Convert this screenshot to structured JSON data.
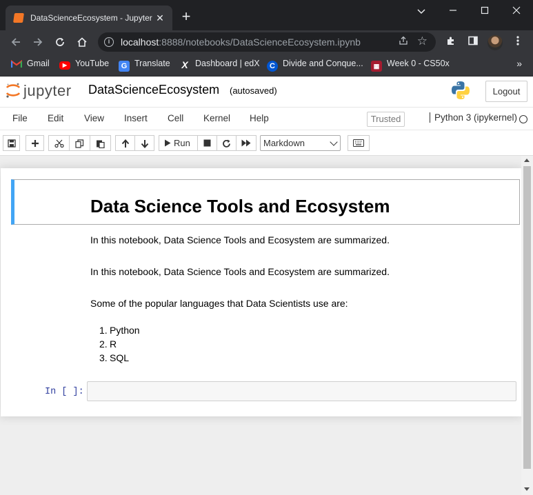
{
  "browser": {
    "tab_title": "DataScienceEcosystem - Jupyter Notebook",
    "url_host": "localhost",
    "url_rest": ":8888/notebooks/DataScienceEcosystem.ipynb",
    "bookmarks": [
      {
        "label": "Gmail",
        "icon": "gmail-icon",
        "color": "#ea4335"
      },
      {
        "label": "YouTube",
        "icon": "youtube-icon",
        "color": "#ff0000"
      },
      {
        "label": "Translate",
        "icon": "translate-icon",
        "color": "#4285f4"
      },
      {
        "label": "Dashboard | edX",
        "icon": "edx-icon",
        "color": "#ffffff"
      },
      {
        "label": "Divide and Conque...",
        "icon": "coursera-icon",
        "color": "#0056d2"
      },
      {
        "label": "Week 0 - CS50x",
        "icon": "harvard-icon",
        "color": "#a51c30"
      }
    ]
  },
  "jupyter": {
    "logo_text": "jupyter",
    "notebook_name": "DataScienceEcosystem",
    "autosave": "(autosaved)",
    "logout": "Logout",
    "menu": [
      "File",
      "Edit",
      "View",
      "Insert",
      "Cell",
      "Kernel",
      "Help"
    ],
    "trusted": "Trusted",
    "kernel": "Python 3 (ipykernel)",
    "run_label": "Run",
    "cell_type": "Markdown"
  },
  "notebook": {
    "heading": "Data Science Tools and Ecosystem",
    "para1": "In this notebook, Data Science Tools and Ecosystem are summarized.",
    "para2": "In this notebook, Data Science Tools and Ecosystem are summarized.",
    "para3": "Some of the popular languages that Data Scientists use are:",
    "languages": [
      "Python",
      "R",
      "SQL"
    ],
    "prompt": "In [ ]:"
  },
  "colors": {
    "selected_cell_bar": "#42a5f5",
    "jupyter_orange": "#f37726",
    "prompt_blue": "#303f9f"
  }
}
